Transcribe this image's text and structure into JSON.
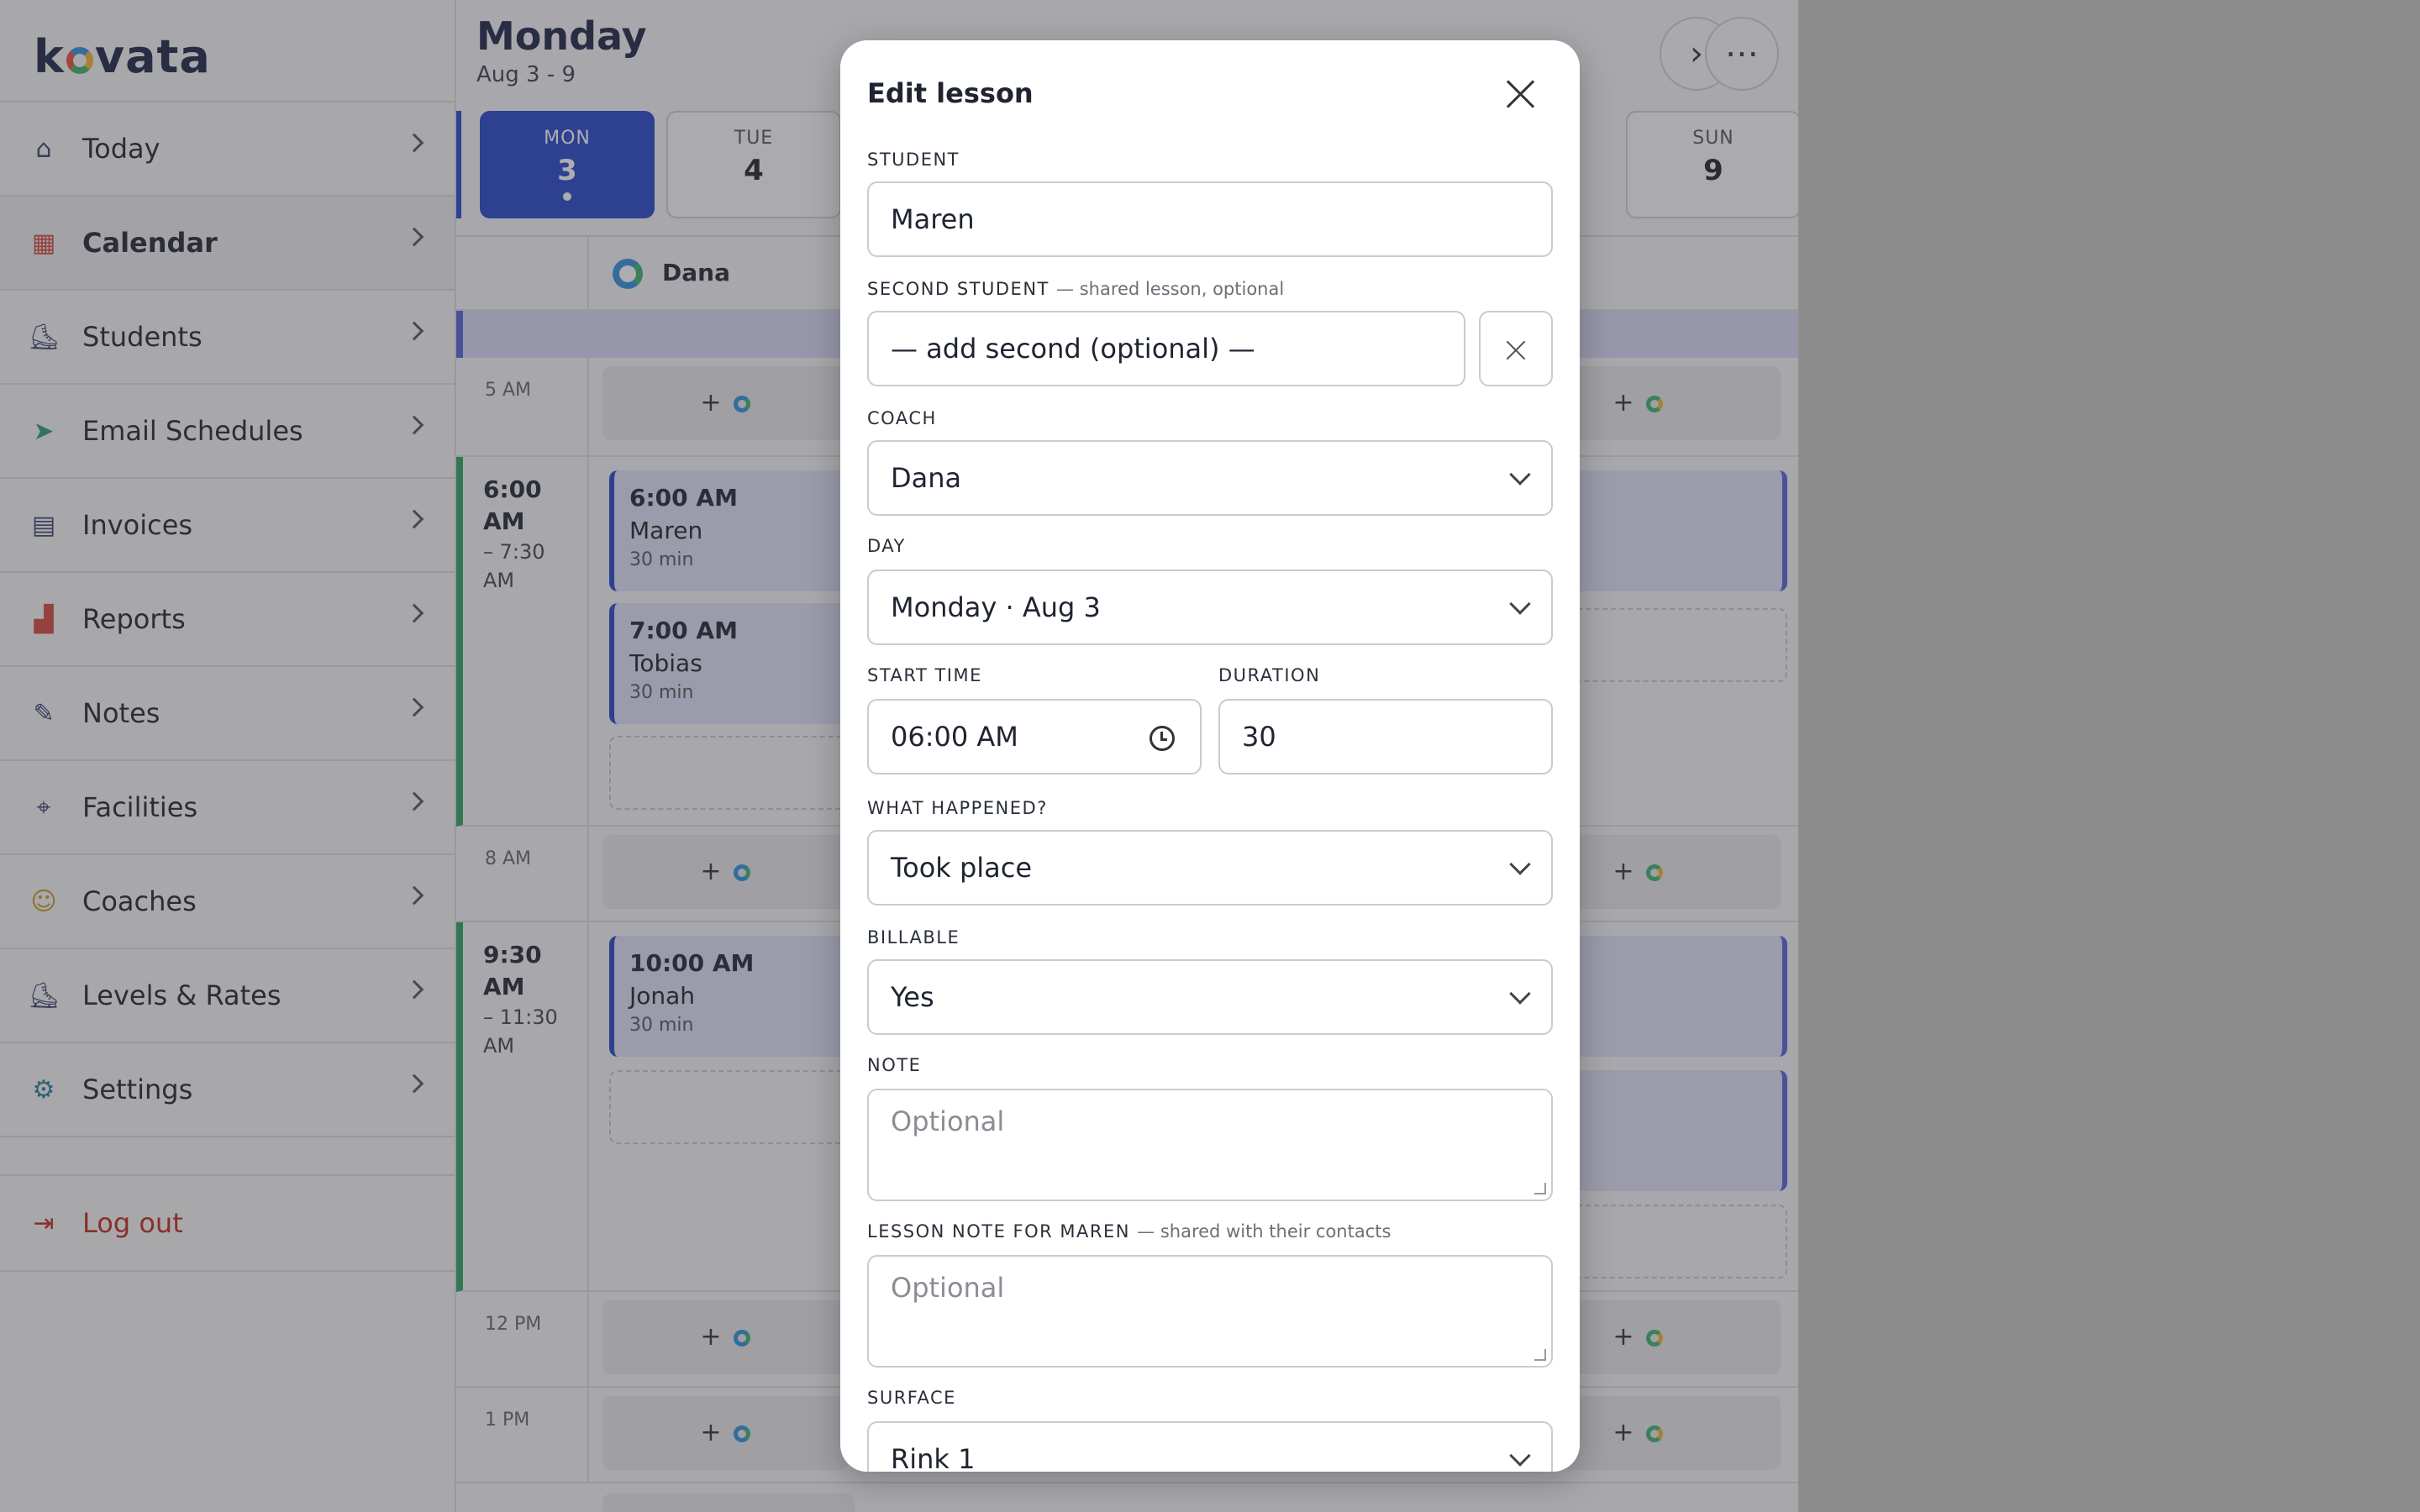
{
  "app": {
    "logo_pre": "k",
    "logo_post": "vata"
  },
  "sidebar": {
    "items": [
      {
        "label": "Today",
        "icon": "home-icon"
      },
      {
        "label": "Calendar",
        "icon": "calendar-icon"
      },
      {
        "label": "Students",
        "icon": "skater-icon"
      },
      {
        "label": "Email Schedules",
        "icon": "send-icon"
      },
      {
        "label": "Invoices",
        "icon": "invoice-icon"
      },
      {
        "label": "Reports",
        "icon": "bar-chart-icon"
      },
      {
        "label": "Notes",
        "icon": "note-icon"
      },
      {
        "label": "Facilities",
        "icon": "location-pin-icon"
      },
      {
        "label": "Coaches",
        "icon": "coach-icon"
      },
      {
        "label": "Levels & Rates",
        "icon": "skate-icon"
      },
      {
        "label": "Settings",
        "icon": "gear-icon"
      }
    ],
    "logout": "Log out"
  },
  "calendar": {
    "title": "Monday",
    "range": "Aug 3 - 9",
    "days": [
      {
        "name": "MON",
        "date": "3"
      },
      {
        "name": "TUE",
        "date": "4"
      },
      {
        "name": "SUN",
        "date": "9"
      }
    ],
    "coach": "Dana",
    "slots": [
      "5 AM",
      "8 AM",
      "12 PM",
      "1 PM"
    ],
    "blocks": [
      {
        "start": "6:00",
        "ampm": "AM",
        "end": "– 7:30",
        "end_ampm": "AM"
      },
      {
        "start": "9:30",
        "ampm": "AM",
        "end": "– 11:30",
        "end_ampm": "AM"
      }
    ],
    "lessons": [
      {
        "time": "6:00 AM",
        "student": "Maren",
        "duration": "30 min"
      },
      {
        "time": "7:00 AM",
        "student": "Tobias",
        "duration": "30 min"
      },
      {
        "time": "10:00 AM",
        "student": "Jonah",
        "duration": "30 min"
      }
    ],
    "add_symbol": "+"
  },
  "modal": {
    "title": "Edit lesson",
    "student_label": "STUDENT",
    "student_value": "Maren",
    "second_label": "SECOND STUDENT",
    "second_hint": "— shared lesson, optional",
    "second_value": "— add second (optional) —",
    "coach_label": "COACH",
    "coach_value": "Dana",
    "day_label": "DAY",
    "day_value": "Monday · Aug 3",
    "start_label": "START TIME",
    "start_value": "06:00  AM",
    "duration_label": "DURATION",
    "duration_value": "30",
    "happened_label": "WHAT HAPPENED?",
    "happened_value": "Took place",
    "billable_label": "BILLABLE",
    "billable_value": "Yes",
    "note_label": "NOTE",
    "note_placeholder": "Optional",
    "lesson_note_label": "LESSON NOTE FOR MAREN",
    "lesson_note_hint": "— shared with their contacts",
    "lesson_note_placeholder": "Optional",
    "surface_label": "SURFACE",
    "surface_value": "Rink 1"
  },
  "colors": {
    "accent": "#2445c8",
    "logout": "#c0281c",
    "block": "#2aa25c"
  }
}
